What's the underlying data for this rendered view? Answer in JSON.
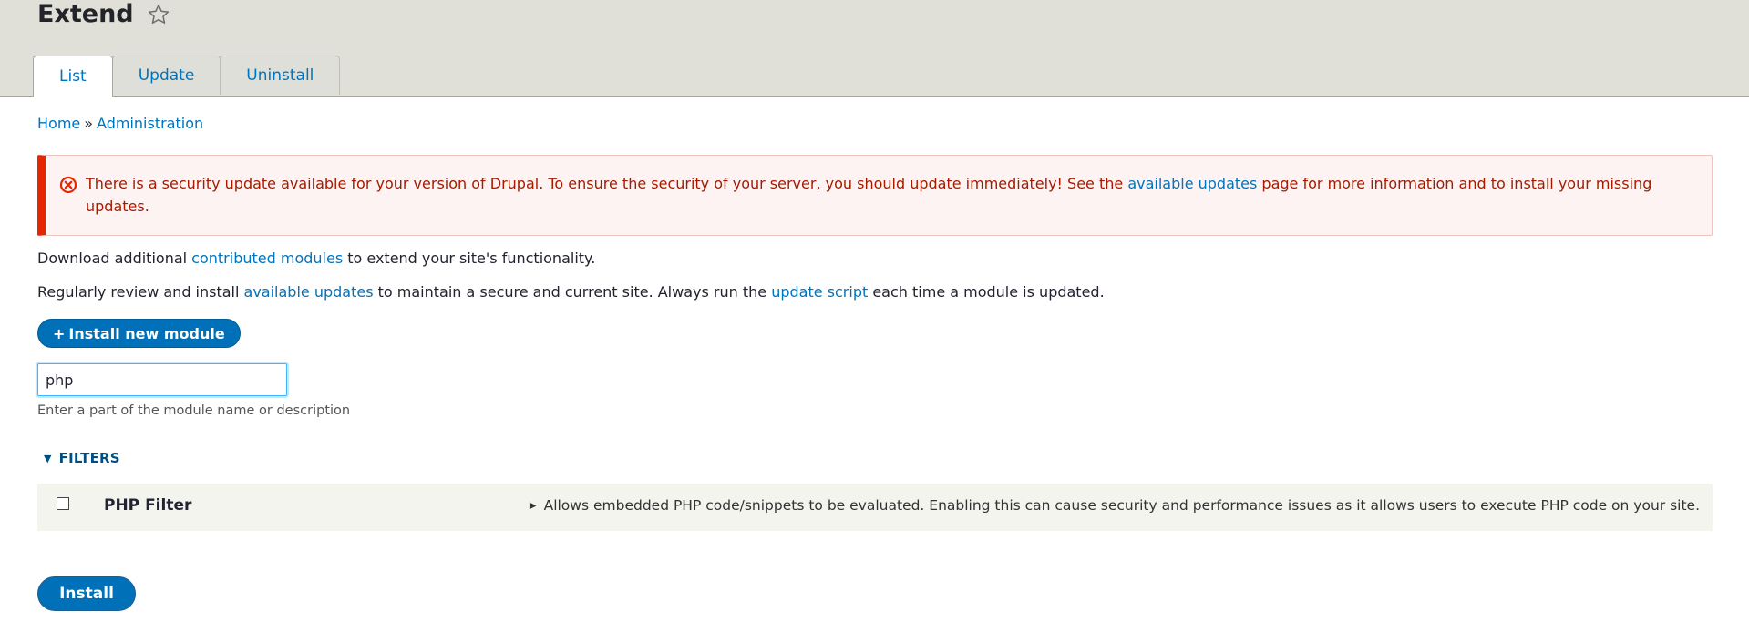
{
  "header": {
    "title": "Extend",
    "tabs": [
      {
        "label": "List"
      },
      {
        "label": "Update"
      },
      {
        "label": "Uninstall"
      }
    ]
  },
  "breadcrumb": {
    "home": "Home",
    "separator": "»",
    "current": "Administration"
  },
  "alert": {
    "text_before": "There is a security update available for your version of Drupal. To ensure the security of your server, you should update immediately! See the ",
    "link": "available updates",
    "text_after": " page for more information and to install your missing updates."
  },
  "intro": {
    "p1_before": "Download additional ",
    "p1_link": "contributed modules",
    "p1_after": " to extend your site's functionality.",
    "p2_before": "Regularly review and install ",
    "p2_link1": "available updates",
    "p2_middle": " to maintain a secure and current site. Always run the ",
    "p2_link2": "update script",
    "p2_after": " each time a module is updated."
  },
  "install_new": {
    "plus": "+",
    "label": "Install new module"
  },
  "search": {
    "value": "php",
    "description": "Enter a part of the module name or description"
  },
  "filters": {
    "label": "FILTERS"
  },
  "modules": [
    {
      "name": "PHP Filter",
      "description": "Allows embedded PHP code/snippets to be evaluated. Enabling this can cause security and performance issues as it allows users to execute PHP code on your site.",
      "checked": false
    }
  ],
  "actions": {
    "install_label": "Install"
  },
  "colors": {
    "link": "#0074bd",
    "primary_button": "#0071b8",
    "error": "#e62600",
    "header_bg": "#e0e0d8"
  },
  "icons": {
    "favorite": "star-outline-icon",
    "alert": "error-circle-icon"
  }
}
